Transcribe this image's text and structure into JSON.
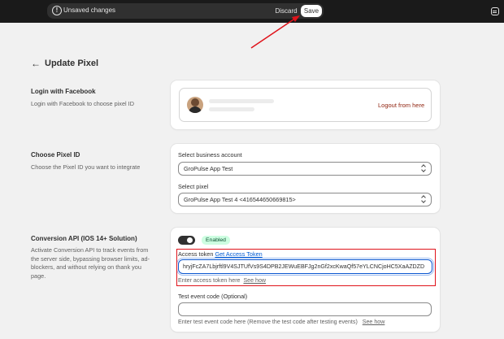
{
  "topbar": {
    "unsaved_label": "Unsaved changes",
    "discard_label": "Discard",
    "save_label": "Save",
    "info_icon": "info-icon",
    "profile_icon": "store-icon"
  },
  "header": {
    "back_icon": "←",
    "title": "Update Pixel"
  },
  "login_section": {
    "title": "Login with Facebook",
    "description": "Login with Facebook to choose pixel ID",
    "logout_label": "Logout from here"
  },
  "pixel_section": {
    "title": "Choose Pixel ID",
    "description": "Choose the Pixel ID you want to integrate",
    "business_label": "Select business account",
    "business_value": "GroPulse App Test",
    "pixel_label": "Select pixel",
    "pixel_value": "GroPulse App Test 4 <416544650669815>"
  },
  "capi_section": {
    "title": "Conversion API (IOS 14+ Solution)",
    "description": "Activate Conversion API to track events from the server side, bypassing browser limits, ad-blockers, and without relying on thank you page.",
    "toggle_state": "on",
    "status_badge": "Enabled",
    "access_token_label": "Access token",
    "get_token_link": "Get Access Token",
    "access_token_value": "hryjFcZA7Lbjrftl9V4SJTUfVs9S4DPB2JEWuEBFJg2nGf2xcKwaQf57eYLCNCjoHC5XaAZDZD",
    "access_token_help": "Enter access token here",
    "see_how_label": "See how",
    "test_code_label": "Test event code (Optional)",
    "test_code_value": "",
    "test_code_help": "Enter test event code here (Remove the test code after testing events)",
    "test_see_how_label": "See how"
  },
  "colors": {
    "topbar_bg": "#1a1a1a",
    "annotation_red": "#e0131b",
    "badge_bg": "#cdfee1",
    "link_blue": "#005bd3",
    "logout_red": "#8e1f0b"
  }
}
